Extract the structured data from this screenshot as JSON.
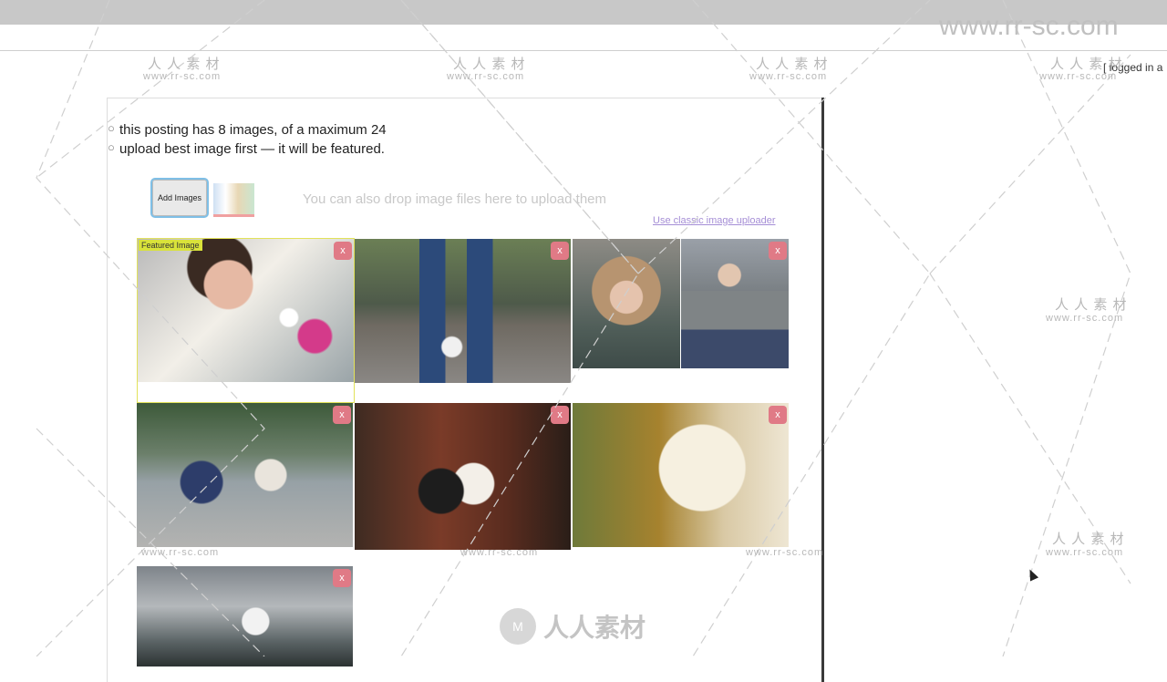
{
  "header": {
    "logged_text": "[ logged in a"
  },
  "info": {
    "line1": "this posting has 8 images, of a maximum 24",
    "line2": "upload best image first — it will be featured."
  },
  "uploader": {
    "add_button_label": "Add Images",
    "drop_hint": "You can also drop image files here to upload them",
    "classic_link": "Use classic image uploader"
  },
  "images": [
    {
      "featured": true,
      "featured_label": "Featured Image",
      "delete_label": "x",
      "icon": "wedding-bride-photo"
    },
    {
      "featured": false,
      "delete_label": "x",
      "icon": "child-standing-photo"
    },
    {
      "featured": false,
      "delete_label": "",
      "icon": "woman-fur-hood-photo"
    },
    {
      "featured": false,
      "delete_label": "x",
      "icon": "woman-rocks-photo"
    },
    {
      "featured": false,
      "delete_label": "x",
      "icon": "family-lake-photo"
    },
    {
      "featured": false,
      "delete_label": "x",
      "icon": "couple-kiss-photo"
    },
    {
      "featured": false,
      "delete_label": "x",
      "icon": "bride-veil-photo"
    },
    {
      "featured": false,
      "delete_label": "x",
      "icon": "bride-field-photo"
    }
  ],
  "watermark": {
    "site_big": "www.rr-sc.com",
    "cn_label": "人 人 素 材",
    "url_label": "www.rr-sc.com",
    "bottom_text": "人人素材",
    "logo_text": "M"
  }
}
